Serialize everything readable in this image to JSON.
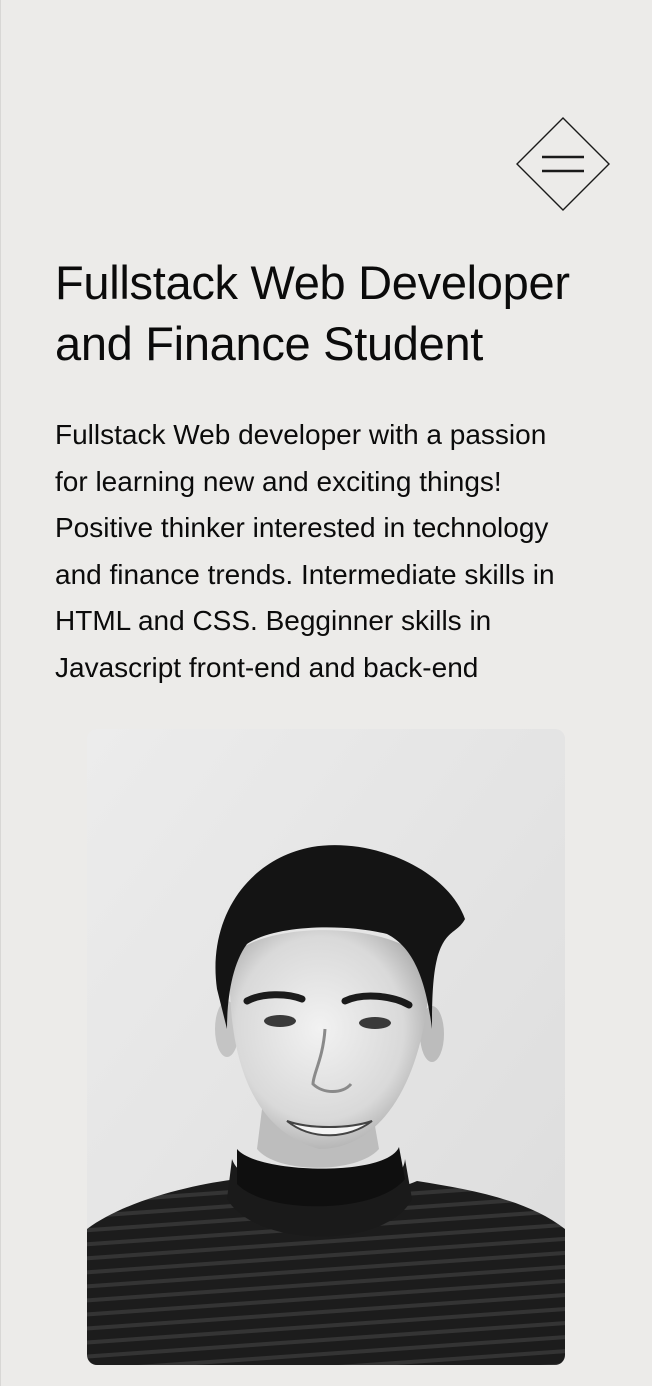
{
  "header": {
    "menu_icon": "hamburger-diamond-icon"
  },
  "hero": {
    "title_line1": "Fullstack Web Developer",
    "title_line2": "and Finance Student",
    "description_lines": [
      "Fullstack Web developer with a passion",
      "for learning new and exciting things!",
      "Positive thinker interested in technology",
      "and finance trends. Intermediate skills in",
      "HTML and CSS. Begginner skills in",
      "Javascript front-end and back-end"
    ]
  },
  "colors": {
    "background": "#ecebe9",
    "text": "#0b0b0b"
  }
}
